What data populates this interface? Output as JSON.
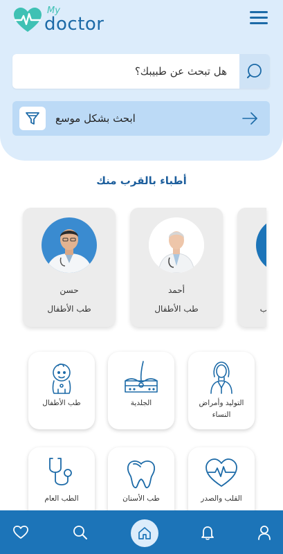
{
  "header": {
    "logo_my": "My",
    "logo_doctor": "doctor"
  },
  "search": {
    "placeholder": "هل تبحث عن طبيبك؟"
  },
  "advanced_search": {
    "label": "ابحث بشكل موسع"
  },
  "nearby": {
    "title": "أطباء بالقرب منك",
    "doctors": [
      {
        "name": "حسن",
        "specialty": "طب الأطفال"
      },
      {
        "name": "أحمد",
        "specialty": "طب الأطفال"
      },
      {
        "name": "",
        "specialty": "طب"
      }
    ]
  },
  "specialties": [
    {
      "label": "طب الأطفال",
      "icon": "baby-icon"
    },
    {
      "label": "الجلدية",
      "icon": "skin-icon"
    },
    {
      "label": "التوليد وأمراض النساء",
      "icon": "woman-icon"
    },
    {
      "label": "الطب العام",
      "icon": "stethoscope-icon"
    },
    {
      "label": "طب الأسنان",
      "icon": "tooth-icon"
    },
    {
      "label": "القلب والصدر",
      "icon": "heart-pulse-icon"
    }
  ],
  "bottom_nav": [
    "heart-icon",
    "search-icon",
    "home-icon",
    "bell-icon",
    "user-icon"
  ],
  "colors": {
    "primary": "#1c74b8",
    "dark_blue": "#1c5e9c",
    "teal": "#3fc1b4",
    "panel": "#dcecfb",
    "advanced": "#bcdaf6"
  }
}
